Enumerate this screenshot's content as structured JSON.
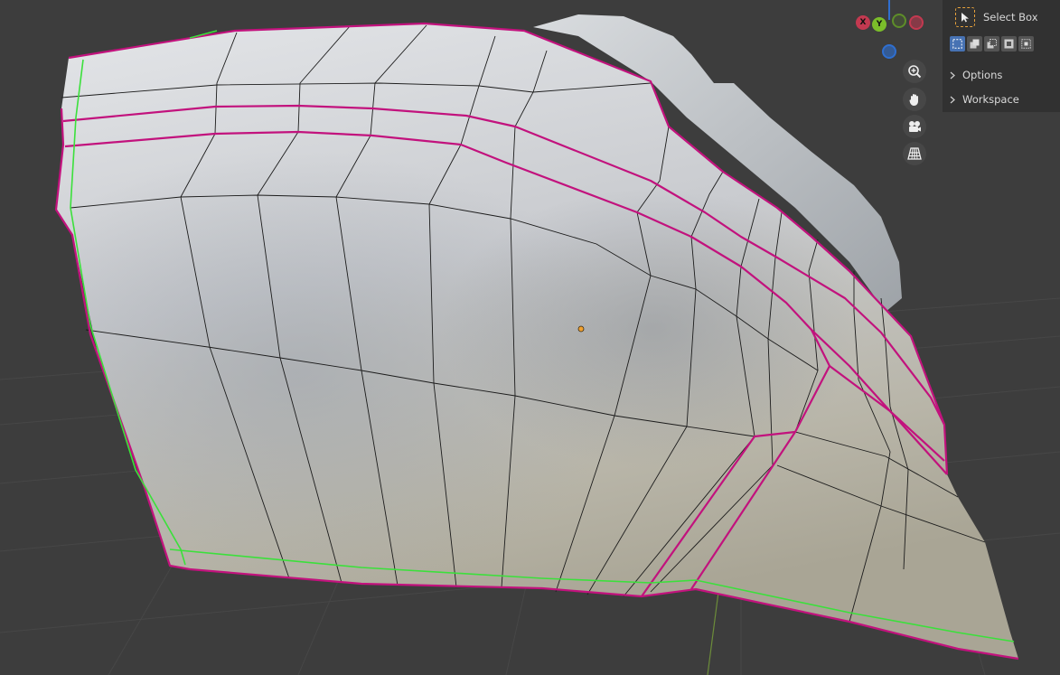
{
  "colors": {
    "background": "#3d3d3d",
    "seam": "#c2127d",
    "selected_edge": "#3be03b",
    "axis_x": "#c33950",
    "axis_y": "#7bbd2a",
    "axis_z": "#2f6fd0",
    "accent_active": "#4772b3",
    "tool_frame": "#e8a23c"
  },
  "gizmo": {
    "x_label": "X",
    "y_label": "Y"
  },
  "navigation": [
    "zoom-icon",
    "hand-pan-icon",
    "camera-icon",
    "grid-perspective-icon"
  ],
  "sidebar": {
    "active_tool": "Select Box",
    "selection_modes": [
      "new",
      "extend",
      "subtract",
      "invert",
      "intersect"
    ],
    "active_mode_index": 0,
    "panels": [
      {
        "label": "Options"
      },
      {
        "label": "Workspace"
      }
    ]
  }
}
